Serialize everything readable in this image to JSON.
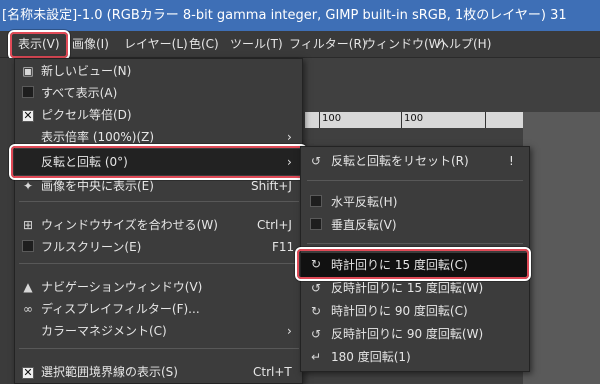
{
  "window": {
    "title": "[名称未設定]-1.0 (RGBカラー 8-bit gamma integer, GIMP built-in sRGB, 1枚のレイヤー) 31"
  },
  "menubar": {
    "items": [
      "表示(V)",
      "画像(I)",
      "レイヤー(L)",
      "色(C)",
      "ツール(T)",
      "フィルター(R)",
      "ウィンドウ(W)",
      "ヘルプ(H)"
    ]
  },
  "ruler": {
    "label": "100",
    "mark": "|100"
  },
  "view_menu": {
    "items": [
      {
        "label": "新しいビュー(N)",
        "icon": "new-view-icon"
      },
      {
        "label": "すべて表示(A)",
        "icon": "checkbox-off"
      },
      {
        "label": "ピクセル等倍(D)",
        "icon": "checkbox-on"
      },
      {
        "label": "表示倍率 (100%)(Z)",
        "submenu": true
      },
      {
        "label": "反転と回転 (0°)",
        "submenu": true
      },
      {
        "label": "画像を中央に表示(E)",
        "shortcut": "Shift+J",
        "icon": "center-icon"
      },
      {
        "label": "ウィンドウサイズを合わせる(W)",
        "shortcut": "Ctrl+J",
        "icon": "shrink-wrap-icon"
      },
      {
        "label": "フルスクリーン(E)",
        "shortcut": "F11",
        "icon": "checkbox-off"
      },
      {
        "label": "ナビゲーションウィンドウ(V)",
        "icon": "navigation-icon"
      },
      {
        "label": "ディスプレイフィルター(F)...",
        "icon": "display-filter-icon"
      },
      {
        "label": "カラーマネジメント(C)",
        "submenu": true
      },
      {
        "label": "選択範囲境界線の表示(S)",
        "shortcut": "Ctrl+T",
        "icon": "checkbox-on"
      }
    ]
  },
  "flip_menu": {
    "items": [
      {
        "label": "反転と回転をリセット(R)",
        "shortcut": "!",
        "icon": "reset-icon"
      },
      {
        "label": "水平反転(H)",
        "icon": "checkbox-off"
      },
      {
        "label": "垂直反転(V)",
        "icon": "checkbox-off"
      },
      {
        "label": "時計回りに 15 度回転(C)",
        "icon": "rotate-cw-icon"
      },
      {
        "label": "反時計回りに 15 度回転(W)",
        "icon": "rotate-ccw-icon"
      },
      {
        "label": "時計回りに 90 度回転(C)",
        "icon": "rotate-cw-icon"
      },
      {
        "label": "反時計回りに 90 度回転(W)",
        "icon": "rotate-ccw-icon"
      },
      {
        "label": "180 度回転(1)",
        "icon": "rotate-180-icon"
      }
    ]
  },
  "colors": {
    "titlebar": "#3e6fb6",
    "highlight": "#e04a57",
    "menu_bg": "#3c3c3c"
  }
}
